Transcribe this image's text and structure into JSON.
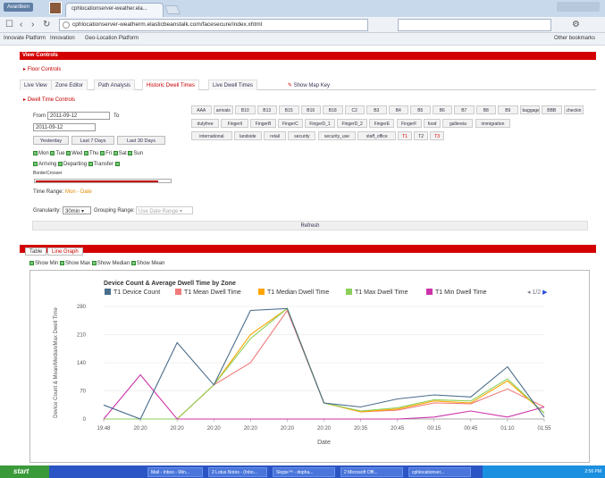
{
  "browser": {
    "user_label": "Avantken",
    "tab_title": "cphlocationserver-weather.ela...",
    "url": "cphlocationserver-weatherm.elasticbeanstalk.com/facesecure/index.xhtml",
    "bookmarks": [
      "Innovate Platform",
      "Innovation",
      "Geo-Location Platform"
    ],
    "other_bookmarks": "Other bookmarks"
  },
  "page": {
    "header": "View Controls",
    "floor_controls": "Floor Controls",
    "nav_tabs": [
      "Live View",
      "Zone Editor",
      "Path Analysis",
      "Historic Dwell Times",
      "Live Dwell Times"
    ],
    "active_nav": "Historic Dwell Times",
    "show_map_key": "Show Map Key",
    "dwell_controls": "Dwell Time Controls",
    "from_label": "From",
    "from_value": "2011-09-12",
    "to_label": "To",
    "to_value": "2011-09-12",
    "quick_ranges": [
      "Yesterday",
      "Last 7 Days",
      "Last 30 Days"
    ],
    "days": [
      "Mon",
      "Tue",
      "Wed",
      "Thu",
      "Fri",
      "Sat",
      "Sun"
    ],
    "directions": [
      "Arriving",
      "Departing",
      "Transfer"
    ],
    "border_crosser": "BorderCrosser",
    "time_range_label": "Time Range:",
    "time_range_value": "Mon - Date",
    "granularity_label": "Granularity:",
    "granularity_value": "30min",
    "grouping_label": "Grouping Range:",
    "grouping_value": "Use Date Range",
    "refresh": "Refresh",
    "progress": 0.9
  },
  "zones": [
    [
      "AAA",
      "arrivals",
      "B10",
      "B13",
      "B15",
      "B16",
      "B18",
      "C2",
      "B3",
      "B4",
      "B5",
      "B6",
      "B7",
      "B8",
      "B9",
      "baggage",
      "BBB",
      "checkin"
    ],
    [
      "dutyfree",
      "Fingeril",
      "FingerB",
      "FingerC",
      "FingerD_1",
      "FingerD_2",
      "FingerE",
      "FingerF",
      "food",
      "gallereia",
      "immigration"
    ],
    [
      "international",
      "landside",
      "retail",
      "security",
      "security_use",
      "staff_office",
      "T1",
      "T2",
      "T3"
    ]
  ],
  "red_zones": [
    "T1",
    "T3"
  ],
  "bottom_tabs": [
    "Table",
    "Line Graph"
  ],
  "active_bottom_tab": "Line Graph",
  "show_options": [
    "Show Min",
    "Show Max",
    "Show Median",
    "Show Mean"
  ],
  "legend_pager": "1/2",
  "colors": {
    "brand_red": "#d30000",
    "device_count": "#4a6d8c",
    "mean": "#f07a7a",
    "median": "#ffa500",
    "max": "#8ccf5a",
    "min": "#cc33aa"
  },
  "chart_data": {
    "type": "line",
    "title": "Device Count & Average Dwell Time by Zone",
    "xlabel": "Date",
    "ylabel": "Device Count & Mean/Median/Max Dwell Time",
    "categories": [
      "19:48",
      "20:20",
      "20:20",
      "20:20",
      "20:20",
      "20:20",
      "20:20",
      "20:35",
      "20:45",
      "00:15",
      "00:45",
      "01:10",
      "01:55"
    ],
    "ylim": [
      0,
      280
    ],
    "yticks": [
      0,
      70,
      140,
      210,
      280
    ],
    "series": [
      {
        "name": "T1 Device Count",
        "color": "#4a6d8c",
        "values": [
          35,
          0,
          190,
          85,
          270,
          275,
          40,
          30,
          50,
          60,
          55,
          130,
          5
        ]
      },
      {
        "name": "T1 Mean Dwell Time",
        "color": "#f07a7a",
        "values": [
          0,
          0,
          0,
          85,
          140,
          270,
          40,
          18,
          22,
          40,
          38,
          75,
          30
        ]
      },
      {
        "name": "T1 Median Dwell Time",
        "color": "#ffa500",
        "values": [
          0,
          0,
          0,
          85,
          210,
          275,
          40,
          18,
          25,
          45,
          40,
          95,
          15
        ]
      },
      {
        "name": "T1 Max Dwell Time",
        "color": "#8ccf5a",
        "values": [
          0,
          0,
          0,
          85,
          200,
          275,
          40,
          20,
          28,
          48,
          45,
          100,
          15
        ]
      },
      {
        "name": "T1 Min Dwell Time",
        "color": "#cc33aa",
        "values": [
          0,
          110,
          0,
          0,
          0,
          0,
          0,
          0,
          0,
          5,
          20,
          5,
          30
        ]
      }
    ]
  },
  "taskbar": {
    "start": "start",
    "tasks": [
      "Mail - Inbox - Win...",
      "2 Lotus Notes - (Inbo...",
      "Skype™ - dopha...",
      "2 Microsoft Offi...",
      "cphlocationser..."
    ],
    "clock": "2:56 PM"
  }
}
